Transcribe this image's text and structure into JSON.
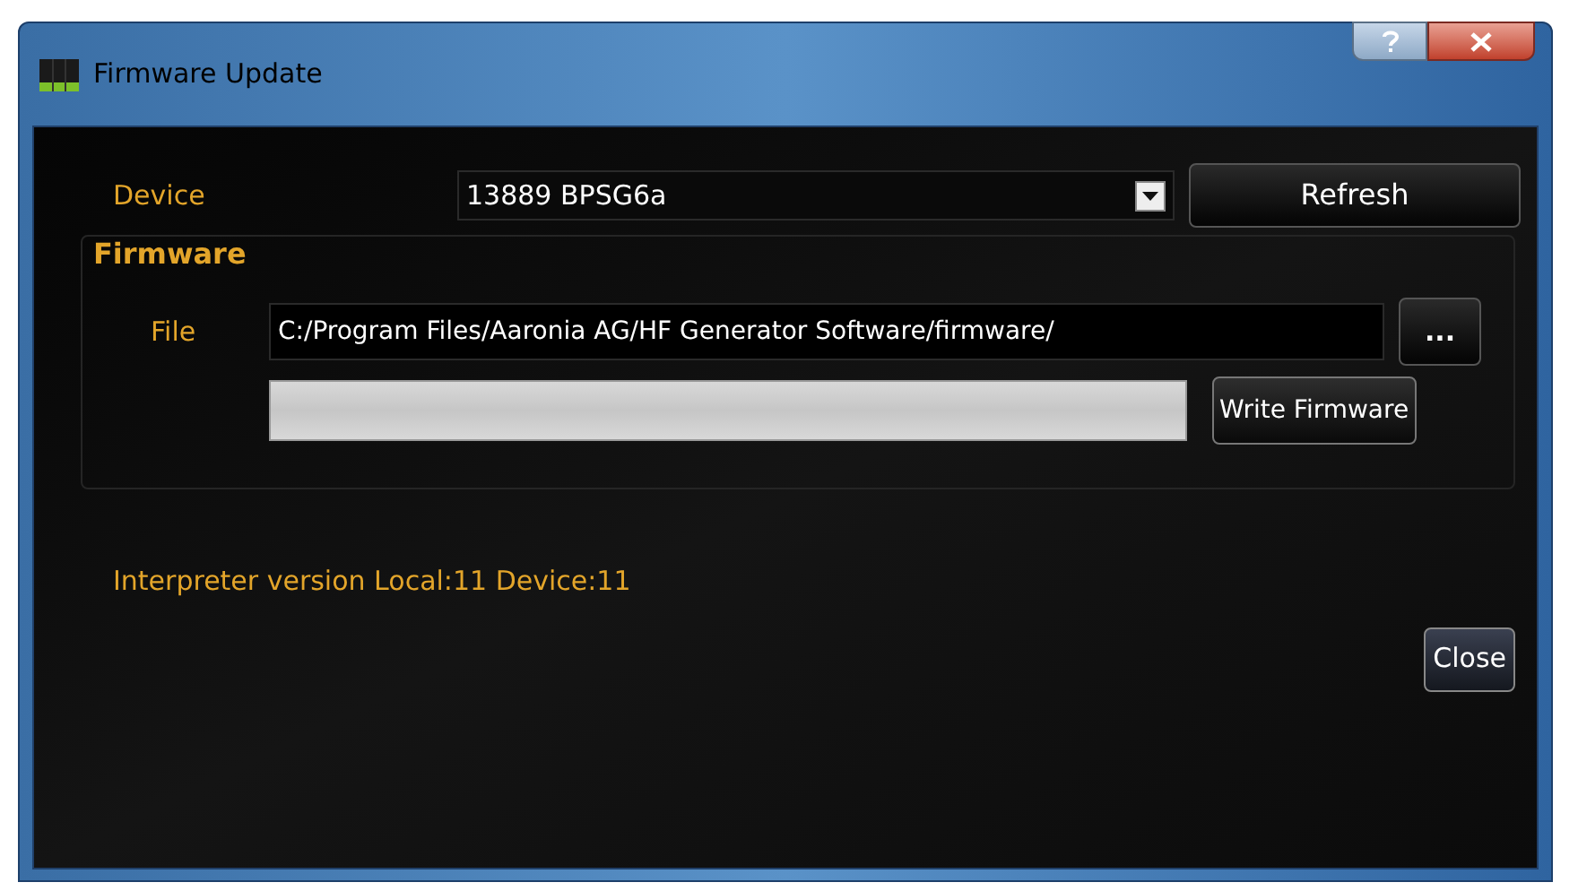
{
  "window": {
    "title": "Firmware Update"
  },
  "device": {
    "label": "Device",
    "value": "13889 BPSG6a",
    "refresh": "Refresh"
  },
  "firmware": {
    "title": "Firmware",
    "file_label": "File",
    "file_value": "C:/Program Files/Aaronia AG/HF Generator Software/firmware/",
    "browse": "...",
    "progress": {
      "level": 0
    },
    "write": "Write Firmware"
  },
  "status": "Interpreter version Local:11 Device:11",
  "buttons": [
    "Close"
  ]
}
